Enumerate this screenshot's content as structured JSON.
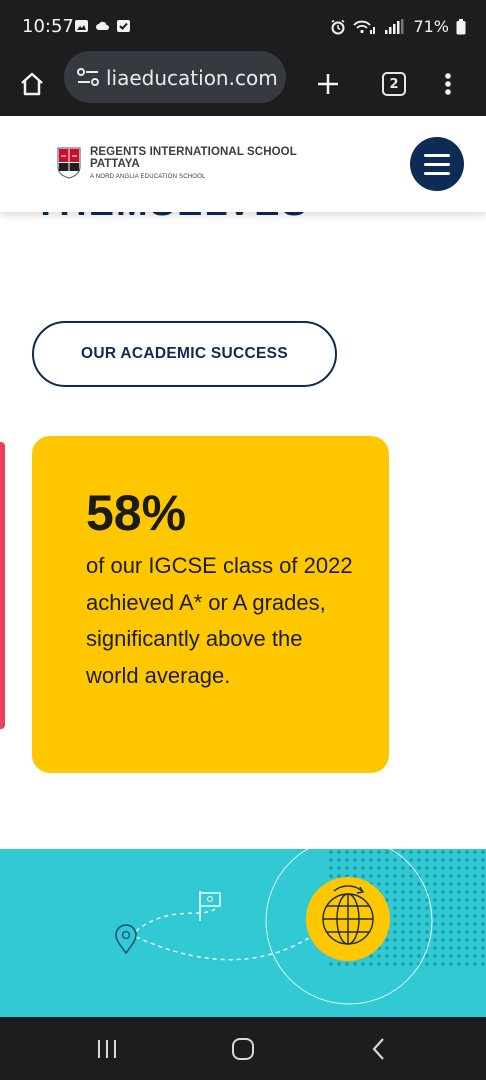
{
  "status_bar": {
    "time": "10:57",
    "battery": "71%"
  },
  "browser": {
    "url": "liaeducation.com",
    "tab_count": "2"
  },
  "header": {
    "school_line1": "REGENTS INTERNATIONAL SCHOOL",
    "school_line2": "PATTAYA",
    "tagline": "A NORD ANGLIA EDUCATION SCHOOL"
  },
  "content": {
    "heading_fragment": "THEMSELVES",
    "cta_label": "OUR ACADEMIC SUCCESS",
    "stat_value": "58%",
    "stat_text": "of our IGCSE class of 2022 achieved A* or A grades, significantly above the world average."
  },
  "colors": {
    "navy": "#0d2b55",
    "yellow": "#fec700",
    "teal": "#30c9d4",
    "red": "#ef3e57"
  }
}
